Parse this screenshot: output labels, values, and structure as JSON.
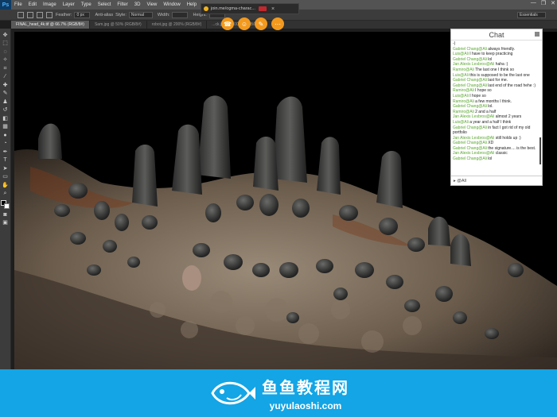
{
  "app": {
    "logo": "Ps"
  },
  "menu": [
    "File",
    "Edit",
    "Image",
    "Layer",
    "Type",
    "Select",
    "Filter",
    "3D",
    "View",
    "Window",
    "Help"
  ],
  "window_controls": [
    "—",
    "❐",
    "✕"
  ],
  "options": {
    "feather_label": "Feather:",
    "feather_value": "0 px",
    "antialias_label": "Anti-alias",
    "style_label": "Style:",
    "style_value": "Normal",
    "width_label": "Width:",
    "height_label": "Height:",
    "workspace": "Essentials"
  },
  "tabs": [
    {
      "label": "FINAL_head_4k.tif @ 66.7% (RGB/8#)"
    },
    {
      "label": "Sam.jpg @ 50% (RGB/8#)"
    },
    {
      "label": "robot.jpg @ 200% (RGB/8#)"
    },
    {
      "label": "...ck.jpg @ 100% (RGB/8#)"
    }
  ],
  "tools": [
    "move",
    "marquee",
    "lasso",
    "magic-wand",
    "crop",
    "eyedropper",
    "healing",
    "brush",
    "stamp",
    "history-brush",
    "eraser",
    "gradient",
    "blur",
    "dodge",
    "pen",
    "type",
    "path-select",
    "shape",
    "hand",
    "zoom"
  ],
  "screenshare": {
    "url": "join.me/ogma-charac...",
    "buttons": [
      "☎",
      "☺",
      "✎",
      "⋯"
    ]
  },
  "chat": {
    "title": "Chat",
    "messages": [
      {
        "user": "",
        "text": "-)"
      },
      {
        "user": "Gabriel Chang@Ali",
        "text": "always friendly."
      },
      {
        "user": "Luis@Ali",
        "text": "I have to keep practicing"
      },
      {
        "user": "Gabriel Chang@Ali",
        "text": "lol"
      },
      {
        "user": "Jan Alexis Lesbros@Ali",
        "text": "haha :)"
      },
      {
        "user": "Ramiro@Ali",
        "text": "The last one I think so"
      },
      {
        "user": "Luis@Ali",
        "text": "this is supposed to be the last one"
      },
      {
        "user": "Gabriel Chang@Ali",
        "text": "last for me."
      },
      {
        "user": "Gabriel Chang@Ali",
        "text": "last end of the road hehe :)"
      },
      {
        "user": "Ramiro@Ali",
        "text": "I hope so"
      },
      {
        "user": "Luis@Ali",
        "text": "I hope so"
      },
      {
        "user": "Ramiro@Ali",
        "text": "a few months I think."
      },
      {
        "user": "Gabriel Chang@Ali",
        "text": "lol."
      },
      {
        "user": "Ramiro@Ali",
        "text": "2 and a half"
      },
      {
        "user": "Jan Alexis Lesbros@Ali",
        "text": "almost 2 years"
      },
      {
        "user": "Luis@Ali",
        "text": "a year and a half I think"
      },
      {
        "user": "Gabriel Chang@Ali",
        "text": "in fact I got rid of my old portfolio"
      },
      {
        "user": "Jan Alexis Lesbros@Ali",
        "text": "still holds up :)"
      },
      {
        "user": "Gabriel Chang@Ali",
        "text": "XD"
      },
      {
        "user": "Gabriel Chang@Ali",
        "text": "the signature.... is the best."
      },
      {
        "user": "Jan Alexis Lesbros@Ali",
        "text": "classic"
      },
      {
        "user": "Gabriel Chang@Ali",
        "text": "lol"
      }
    ],
    "input_prefix": "▸",
    "input_value": "@All"
  },
  "banner": {
    "cn": "鱼鱼教程网",
    "url": "yuyulaoshi.com"
  }
}
